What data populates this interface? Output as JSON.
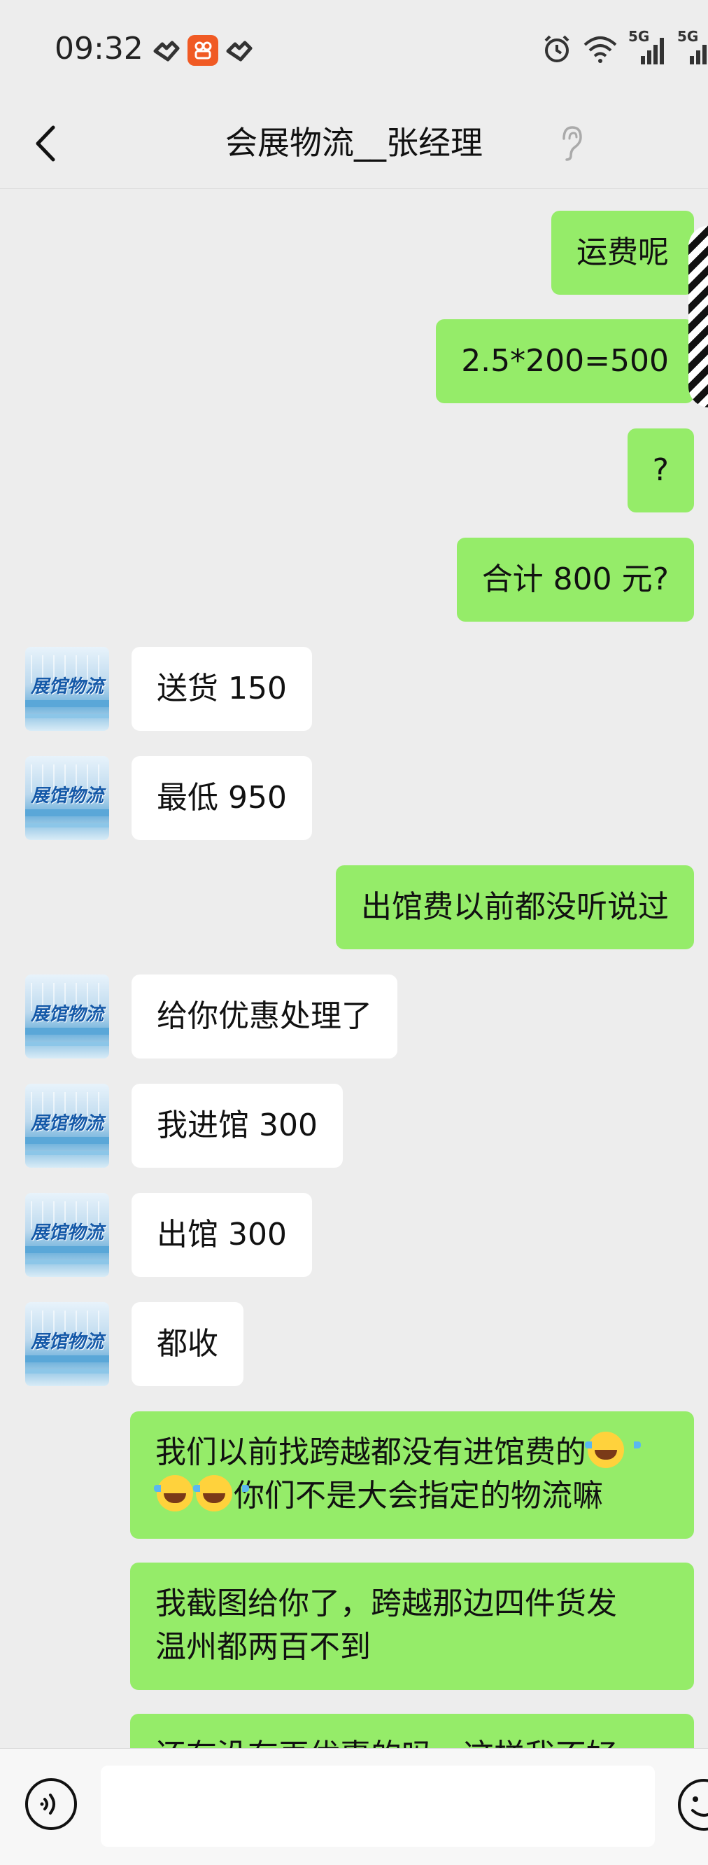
{
  "status": {
    "time": "09:32",
    "signal1_label": "5G",
    "signal2_label": "5G"
  },
  "header": {
    "title": "会展物流__张经理"
  },
  "avatar_label": "展馆物流",
  "messages": [
    {
      "side": "out",
      "text": "运费呢"
    },
    {
      "side": "out",
      "text": "2.5*200=500"
    },
    {
      "side": "out",
      "text": "?"
    },
    {
      "side": "out",
      "text": "合计 800 元?"
    },
    {
      "side": "in",
      "text": "送货 150"
    },
    {
      "side": "in",
      "text": "最低 950"
    },
    {
      "side": "out",
      "text": "出馆费以前都没听说过"
    },
    {
      "side": "in",
      "text": "给你优惠处理了"
    },
    {
      "side": "in",
      "text": "我进馆 300"
    },
    {
      "side": "in",
      "text": "出馆 300"
    },
    {
      "side": "in",
      "text": "都收"
    },
    {
      "side": "out",
      "text_a": "我们以前找跨越都没有进馆费的",
      "text_b": "你们不是大会指定的物流嘛"
    },
    {
      "side": "out",
      "line1": "我截图给你了，跨越那边四件货发",
      "line2": "温州都两百不到"
    },
    {
      "side": "out",
      "text": "还有没有再优惠的吗，这样我不好"
    }
  ],
  "input": {
    "placeholder": ""
  },
  "colors": {
    "outgoing_bubble": "#95ec69",
    "incoming_bubble": "#ffffff",
    "background": "#ededed",
    "app_badge": "#f05a24"
  }
}
